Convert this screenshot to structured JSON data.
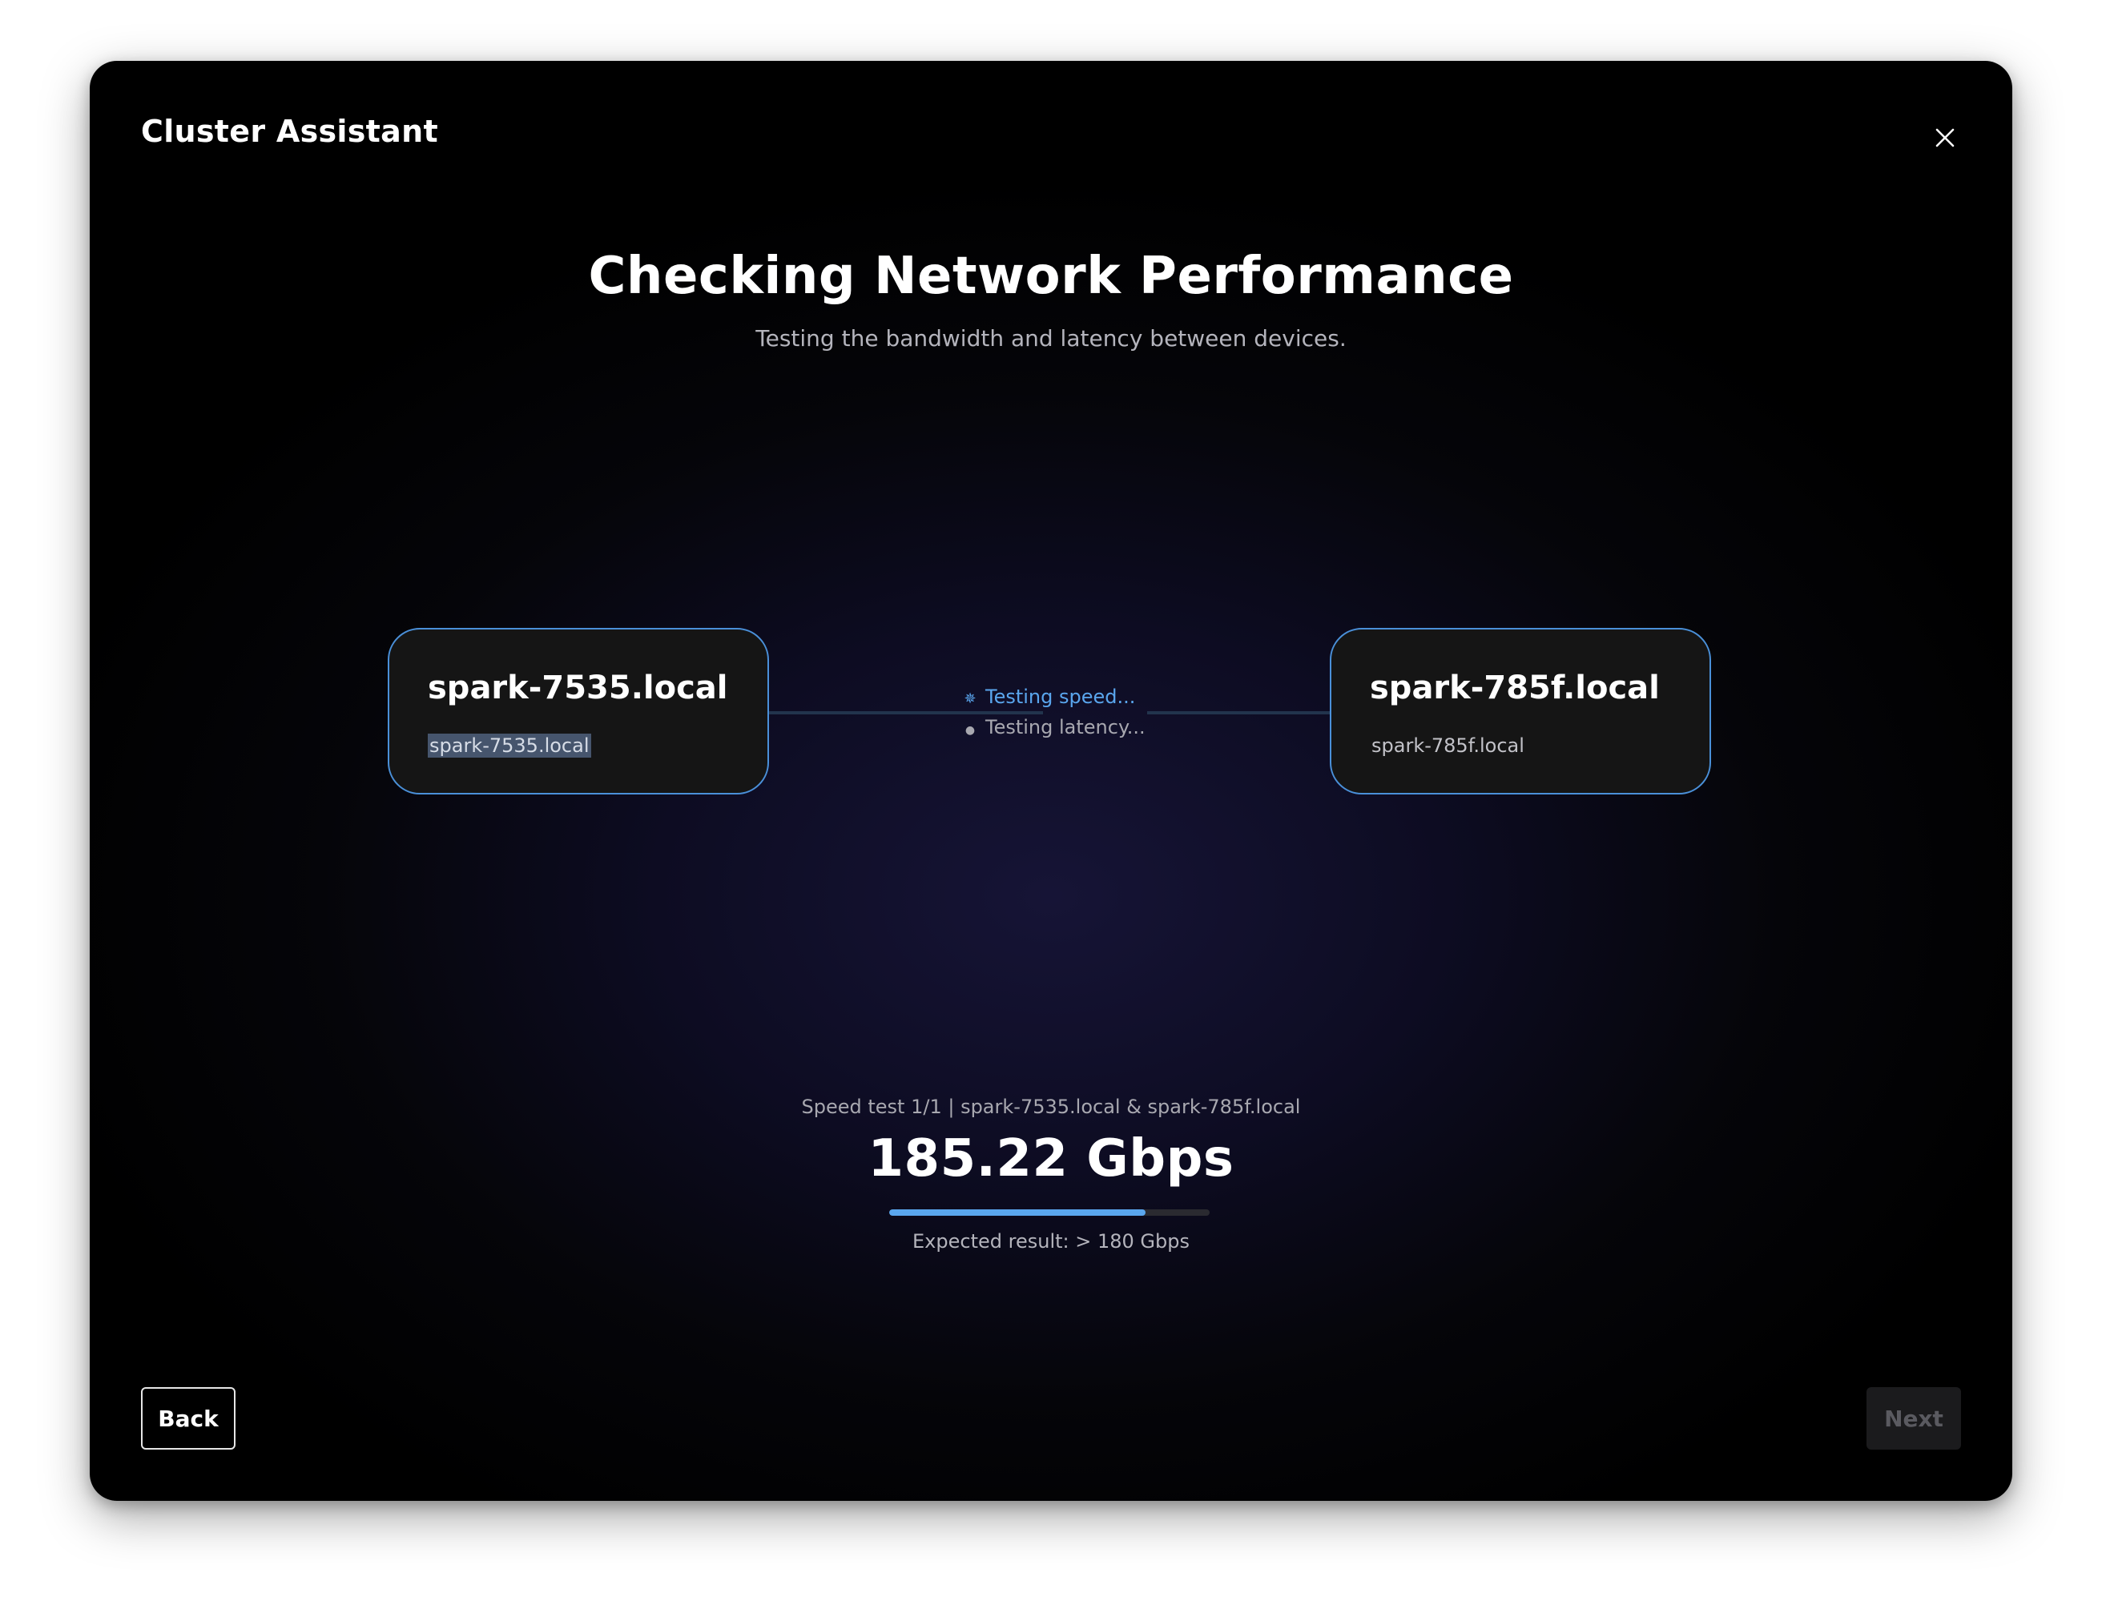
{
  "window": {
    "title": "Cluster Assistant"
  },
  "main": {
    "heading": "Checking Network Performance",
    "subheading": "Testing the bandwidth and latency between devices."
  },
  "devices": [
    {
      "name": "spark-7535.local",
      "host": "spark-7535.local",
      "host_selected": true
    },
    {
      "name": "spark-785f.local",
      "host": "spark-785f.local",
      "host_selected": false
    }
  ],
  "link_status": {
    "speed_label": "Testing speed...",
    "latency_label": "Testing latency...",
    "speed_icon": "spinner-icon",
    "latency_icon": "dot-icon"
  },
  "speed_test": {
    "caption": "Speed test 1/1 | spark-7535.local & spark-785f.local",
    "value": "185.22 Gbps",
    "progress_percent": 80,
    "expected": "Expected result: > 180 Gbps"
  },
  "footer": {
    "back_label": "Back",
    "next_label": "Next",
    "next_disabled": true
  },
  "colors": {
    "accent": "#5aa6ee",
    "card_border": "#4a90d9"
  }
}
